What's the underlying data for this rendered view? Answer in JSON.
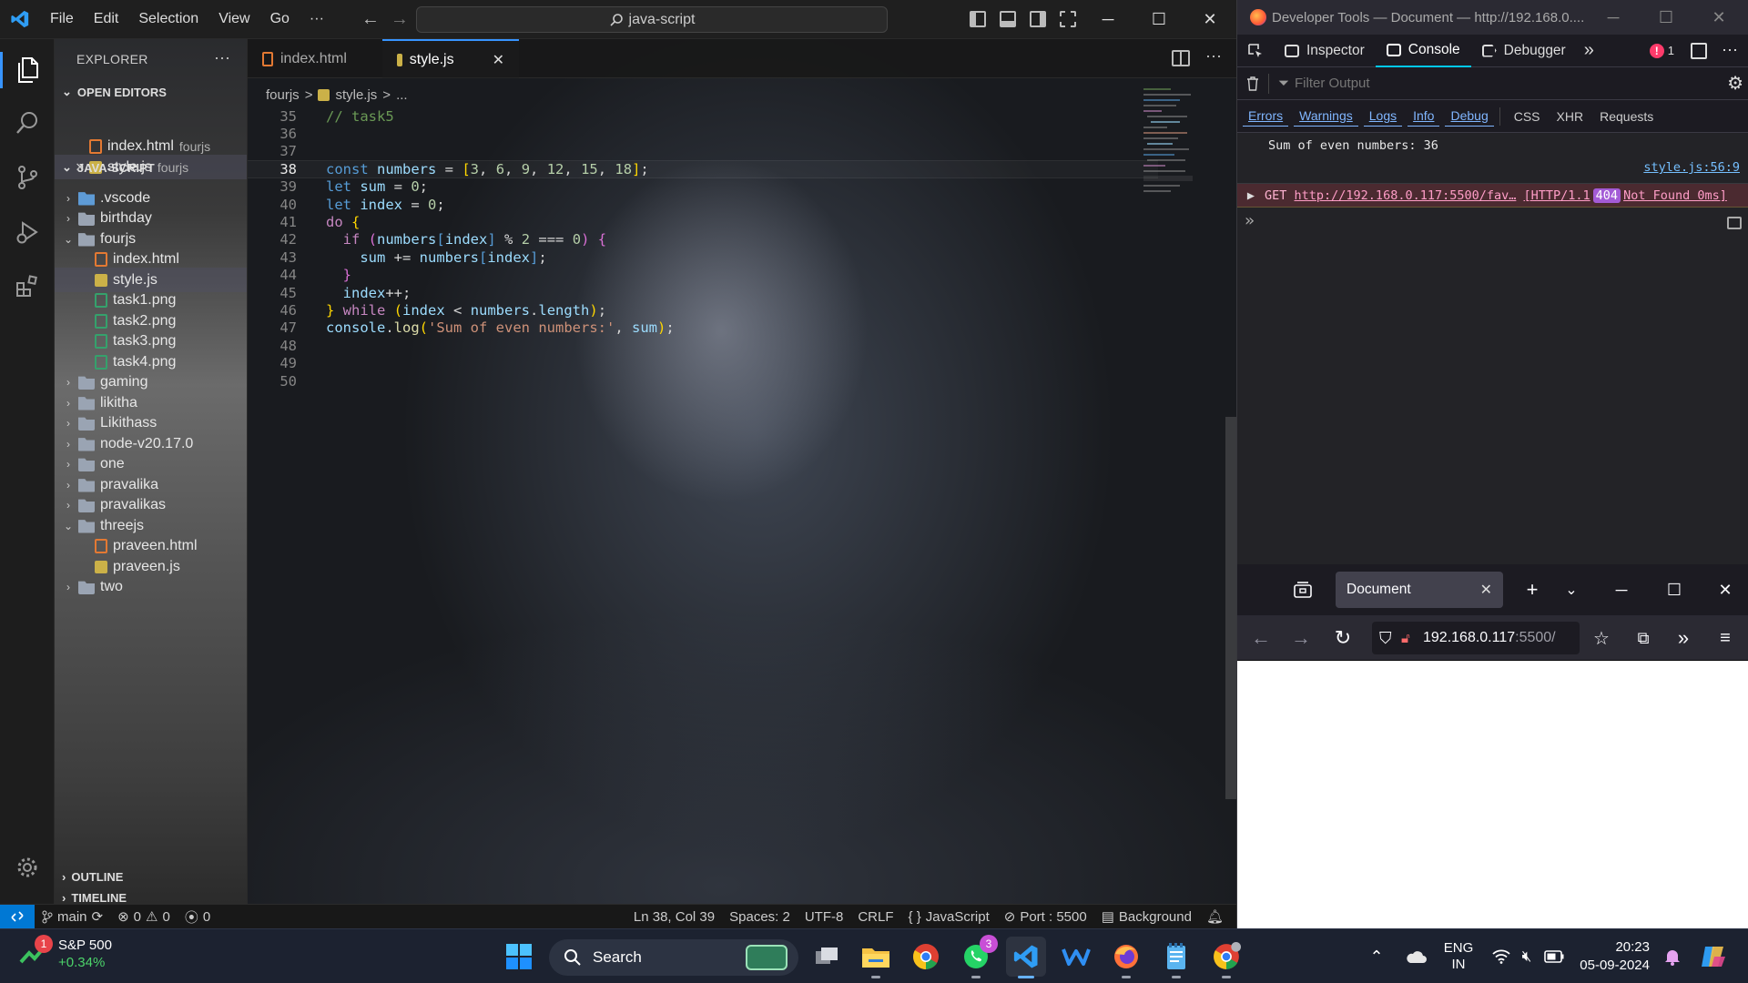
{
  "vscode": {
    "menu": [
      "File",
      "Edit",
      "Selection",
      "View",
      "Go"
    ],
    "more": "···",
    "search_title": "java-script",
    "explorer": {
      "title": "EXPLORER",
      "open_editors_label": "OPEN EDITORS",
      "open_editors": [
        {
          "name": "index.html",
          "desc": "fourjs",
          "icon": "html-file-icon"
        },
        {
          "name": "style.js",
          "desc": "fourjs",
          "icon": "js-file-icon",
          "close": "✕"
        }
      ],
      "workspace_label": "JAVA-SCRIPT",
      "tree": [
        {
          "name": ".vscode",
          "type": "folder",
          "level": 1,
          "open": false,
          "color": "#5e9bd6"
        },
        {
          "name": "birthday",
          "type": "folder",
          "level": 1,
          "open": false
        },
        {
          "name": "fourjs",
          "type": "folder",
          "level": 1,
          "open": true
        },
        {
          "name": "index.html",
          "type": "html",
          "level": 2
        },
        {
          "name": "style.js",
          "type": "js",
          "level": 2,
          "selected": true
        },
        {
          "name": "task1.png",
          "type": "png",
          "level": 2
        },
        {
          "name": "task2.png",
          "type": "png",
          "level": 2
        },
        {
          "name": "task3.png",
          "type": "png",
          "level": 2
        },
        {
          "name": "task4.png",
          "type": "png",
          "level": 2
        },
        {
          "name": "gaming",
          "type": "folder",
          "level": 1,
          "open": false
        },
        {
          "name": "likitha",
          "type": "folder",
          "level": 1,
          "open": false
        },
        {
          "name": "Likithass",
          "type": "folder",
          "level": 1,
          "open": false
        },
        {
          "name": "node-v20.17.0",
          "type": "folder",
          "level": 1,
          "open": false
        },
        {
          "name": "one",
          "type": "folder",
          "level": 1,
          "open": false
        },
        {
          "name": "pravalika",
          "type": "folder",
          "level": 1,
          "open": false
        },
        {
          "name": "pravalikas",
          "type": "folder",
          "level": 1,
          "open": false
        },
        {
          "name": "threejs",
          "type": "folder",
          "level": 1,
          "open": true
        },
        {
          "name": "praveen.html",
          "type": "html",
          "level": 2
        },
        {
          "name": "praveen.js",
          "type": "js",
          "level": 2
        },
        {
          "name": "two",
          "type": "folder",
          "level": 1,
          "open": false
        }
      ],
      "outline_label": "OUTLINE",
      "timeline_label": "TIMELINE"
    },
    "tabs": [
      {
        "label": "index.html",
        "icon": "html-file-icon",
        "active": false
      },
      {
        "label": "style.js",
        "icon": "js-file-icon",
        "active": true,
        "close": "✕"
      }
    ],
    "breadcrumb": [
      "fourjs",
      "style.js",
      "..."
    ],
    "breadcrumb_sep": ">",
    "cursor_line": 38,
    "code_lines": [
      {
        "n": 35,
        "tokens": [
          {
            "t": "// task5",
            "c": "c"
          }
        ]
      },
      {
        "n": 36,
        "tokens": []
      },
      {
        "n": 37,
        "tokens": []
      },
      {
        "n": 38,
        "tokens": [
          {
            "t": "const ",
            "c": "k"
          },
          {
            "t": "numbers",
            "c": "v"
          },
          {
            "t": " = ",
            "c": "o"
          },
          {
            "t": "[",
            "c": "b"
          },
          {
            "t": "3",
            "c": "n"
          },
          {
            "t": ", ",
            "c": "o"
          },
          {
            "t": "6",
            "c": "n"
          },
          {
            "t": ", ",
            "c": "o"
          },
          {
            "t": "9",
            "c": "n"
          },
          {
            "t": ", ",
            "c": "o"
          },
          {
            "t": "12",
            "c": "n"
          },
          {
            "t": ", ",
            "c": "o"
          },
          {
            "t": "15",
            "c": "n"
          },
          {
            "t": ", ",
            "c": "o"
          },
          {
            "t": "18",
            "c": "n"
          },
          {
            "t": "]",
            "c": "b"
          },
          {
            "t": ";",
            "c": "o"
          }
        ]
      },
      {
        "n": 39,
        "tokens": [
          {
            "t": "let ",
            "c": "k"
          },
          {
            "t": "sum",
            "c": "v"
          },
          {
            "t": " = ",
            "c": "o"
          },
          {
            "t": "0",
            "c": "n"
          },
          {
            "t": ";",
            "c": "o"
          }
        ]
      },
      {
        "n": 40,
        "tokens": [
          {
            "t": "let ",
            "c": "k"
          },
          {
            "t": "index",
            "c": "v"
          },
          {
            "t": " = ",
            "c": "o"
          },
          {
            "t": "0",
            "c": "n"
          },
          {
            "t": ";",
            "c": "o"
          }
        ]
      },
      {
        "n": 41,
        "tokens": [
          {
            "t": "do ",
            "c": "kc"
          },
          {
            "t": "{",
            "c": "b"
          }
        ]
      },
      {
        "n": 42,
        "tokens": [
          {
            "t": "  ",
            "c": "o"
          },
          {
            "t": "if ",
            "c": "kc"
          },
          {
            "t": "(",
            "c": "p"
          },
          {
            "t": "numbers",
            "c": "v"
          },
          {
            "t": "[",
            "c": "k"
          },
          {
            "t": "index",
            "c": "v"
          },
          {
            "t": "]",
            "c": "k"
          },
          {
            "t": " % ",
            "c": "o"
          },
          {
            "t": "2",
            "c": "n"
          },
          {
            "t": " === ",
            "c": "o"
          },
          {
            "t": "0",
            "c": "n"
          },
          {
            "t": ")",
            "c": "p"
          },
          {
            "t": " {",
            "c": "p"
          }
        ]
      },
      {
        "n": 43,
        "tokens": [
          {
            "t": "    ",
            "c": "o"
          },
          {
            "t": "sum",
            "c": "v"
          },
          {
            "t": " += ",
            "c": "o"
          },
          {
            "t": "numbers",
            "c": "v"
          },
          {
            "t": "[",
            "c": "k"
          },
          {
            "t": "index",
            "c": "v"
          },
          {
            "t": "]",
            "c": "k"
          },
          {
            "t": ";",
            "c": "o"
          }
        ]
      },
      {
        "n": 44,
        "tokens": [
          {
            "t": "  }",
            "c": "p"
          }
        ]
      },
      {
        "n": 45,
        "tokens": [
          {
            "t": "  ",
            "c": "o"
          },
          {
            "t": "index",
            "c": "v"
          },
          {
            "t": "++;",
            "c": "o"
          }
        ]
      },
      {
        "n": 46,
        "tokens": [
          {
            "t": "} ",
            "c": "b"
          },
          {
            "t": "while ",
            "c": "kc"
          },
          {
            "t": "(",
            "c": "b"
          },
          {
            "t": "index",
            "c": "v"
          },
          {
            "t": " < ",
            "c": "o"
          },
          {
            "t": "numbers",
            "c": "v"
          },
          {
            "t": ".",
            "c": "o"
          },
          {
            "t": "length",
            "c": "v"
          },
          {
            "t": ")",
            "c": "b"
          },
          {
            "t": ";",
            "c": "o"
          }
        ]
      },
      {
        "n": 47,
        "tokens": [
          {
            "t": "console",
            "c": "v"
          },
          {
            "t": ".",
            "c": "o"
          },
          {
            "t": "log",
            "c": "f"
          },
          {
            "t": "(",
            "c": "b"
          },
          {
            "t": "'Sum of even numbers:'",
            "c": "s"
          },
          {
            "t": ", ",
            "c": "o"
          },
          {
            "t": "sum",
            "c": "v"
          },
          {
            "t": ")",
            "c": "b"
          },
          {
            "t": ";",
            "c": "o"
          }
        ]
      },
      {
        "n": 48,
        "tokens": []
      },
      {
        "n": 49,
        "tokens": []
      },
      {
        "n": 50,
        "tokens": []
      }
    ],
    "status": {
      "branch": "main",
      "errors": "0",
      "warnings": "0",
      "ports": "0",
      "position": "Ln 38, Col 39",
      "spaces": "Spaces: 2",
      "encoding": "UTF-8",
      "eol": "CRLF",
      "language": "JavaScript",
      "language_glyph": "{ }",
      "port": "Port : 5500",
      "background": "Background"
    }
  },
  "devtools": {
    "title": "Developer Tools — Document — http://192.168.0....",
    "tabs": [
      {
        "label": "Inspector",
        "icon": "inspector-icon"
      },
      {
        "label": "Console",
        "icon": "console-icon",
        "active": true
      },
      {
        "label": "Debugger",
        "icon": "debugger-icon"
      }
    ],
    "error_count": "1",
    "filter_placeholder": "Filter Output",
    "levels": [
      "Errors",
      "Warnings",
      "Logs",
      "Info",
      "Debug"
    ],
    "types": [
      "CSS",
      "XHR",
      "Requests"
    ],
    "log_message": "Sum of even numbers: 36",
    "log_source": "style.js:56:9",
    "error": {
      "method": "GET",
      "url": "http://192.168.0.117:5500/fav…",
      "proto": "[HTTP/1.1",
      "code": "404",
      "status": "Not Found 0ms]"
    }
  },
  "firefox": {
    "tab_title": "Document",
    "tab_close": "✕",
    "new_tab": "+",
    "url_host": "192.168.0.117",
    "url_rest": ":5500/"
  },
  "taskbar": {
    "stock_name": "S&P 500",
    "stock_change": "+0.34%",
    "stock_badge": "1",
    "search_label": "Search",
    "whatsapp_badge": "3",
    "lang": "ENG",
    "region": "IN",
    "time": "20:23",
    "date": "05-09-2024"
  }
}
